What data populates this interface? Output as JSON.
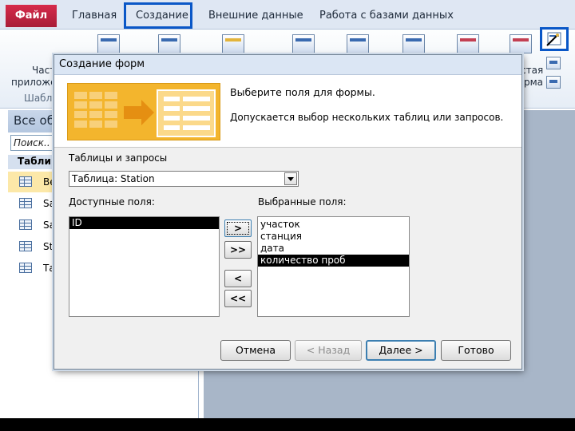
{
  "ribbon_tabs": {
    "file": "Файл",
    "home": "Главная",
    "create": "Создание",
    "external": "Внешние данные",
    "database": "Работа с базами данных"
  },
  "ribbon": {
    "left_top": "Част",
    "left_mid": "приложе",
    "left_group": "Шабло",
    "right_top": "стая",
    "right_mid": "рма"
  },
  "nav": {
    "title": "Все об",
    "search_placeholder": "Поиск..",
    "group": "Табли",
    "items": [
      "Ве",
      "Sa",
      "Sa",
      "St",
      "Та"
    ]
  },
  "dialog": {
    "title": "Создание форм",
    "heading": "Выберите поля для формы.",
    "subheading": "Допускается выбор нескольких таблиц или запросов.",
    "tables_label": "Таблицы и запросы",
    "tables_value": "Таблица: Station",
    "available_label": "Доступные поля:",
    "selected_label": "Выбранные поля:",
    "available_fields": [
      "ID"
    ],
    "selected_fields": [
      "участок",
      "станция",
      "дата",
      "количество проб"
    ],
    "move_one": ">",
    "move_all": ">>",
    "remove_one": "<",
    "remove_all": "<<",
    "cancel": "Отмена",
    "back": "< Назад",
    "next": "Далее >",
    "finish": "Готово"
  },
  "colors": {
    "accent_blue": "#0a57c7",
    "file_tab": "#c0243f",
    "wizard_art": "#f3b52d",
    "selection": "#000000"
  }
}
